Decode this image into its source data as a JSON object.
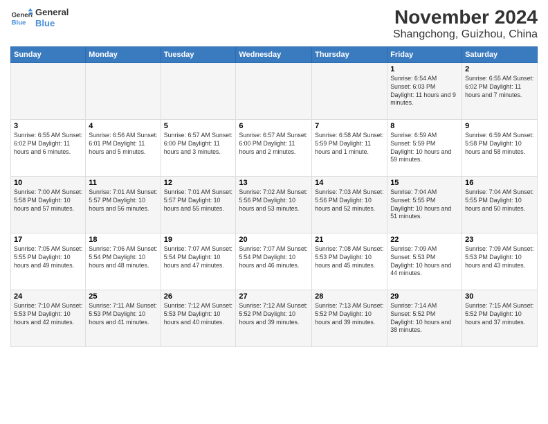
{
  "header": {
    "logo_line1": "General",
    "logo_line2": "Blue",
    "month": "November 2024",
    "location": "Shangchong, Guizhou, China"
  },
  "weekdays": [
    "Sunday",
    "Monday",
    "Tuesday",
    "Wednesday",
    "Thursday",
    "Friday",
    "Saturday"
  ],
  "weeks": [
    [
      {
        "day": "",
        "info": ""
      },
      {
        "day": "",
        "info": ""
      },
      {
        "day": "",
        "info": ""
      },
      {
        "day": "",
        "info": ""
      },
      {
        "day": "",
        "info": ""
      },
      {
        "day": "1",
        "info": "Sunrise: 6:54 AM\nSunset: 6:03 PM\nDaylight: 11 hours and 9 minutes."
      },
      {
        "day": "2",
        "info": "Sunrise: 6:55 AM\nSunset: 6:02 PM\nDaylight: 11 hours and 7 minutes."
      }
    ],
    [
      {
        "day": "3",
        "info": "Sunrise: 6:55 AM\nSunset: 6:02 PM\nDaylight: 11 hours and 6 minutes."
      },
      {
        "day": "4",
        "info": "Sunrise: 6:56 AM\nSunset: 6:01 PM\nDaylight: 11 hours and 5 minutes."
      },
      {
        "day": "5",
        "info": "Sunrise: 6:57 AM\nSunset: 6:00 PM\nDaylight: 11 hours and 3 minutes."
      },
      {
        "day": "6",
        "info": "Sunrise: 6:57 AM\nSunset: 6:00 PM\nDaylight: 11 hours and 2 minutes."
      },
      {
        "day": "7",
        "info": "Sunrise: 6:58 AM\nSunset: 5:59 PM\nDaylight: 11 hours and 1 minute."
      },
      {
        "day": "8",
        "info": "Sunrise: 6:59 AM\nSunset: 5:59 PM\nDaylight: 10 hours and 59 minutes."
      },
      {
        "day": "9",
        "info": "Sunrise: 6:59 AM\nSunset: 5:58 PM\nDaylight: 10 hours and 58 minutes."
      }
    ],
    [
      {
        "day": "10",
        "info": "Sunrise: 7:00 AM\nSunset: 5:58 PM\nDaylight: 10 hours and 57 minutes."
      },
      {
        "day": "11",
        "info": "Sunrise: 7:01 AM\nSunset: 5:57 PM\nDaylight: 10 hours and 56 minutes."
      },
      {
        "day": "12",
        "info": "Sunrise: 7:01 AM\nSunset: 5:57 PM\nDaylight: 10 hours and 55 minutes."
      },
      {
        "day": "13",
        "info": "Sunrise: 7:02 AM\nSunset: 5:56 PM\nDaylight: 10 hours and 53 minutes."
      },
      {
        "day": "14",
        "info": "Sunrise: 7:03 AM\nSunset: 5:56 PM\nDaylight: 10 hours and 52 minutes."
      },
      {
        "day": "15",
        "info": "Sunrise: 7:04 AM\nSunset: 5:55 PM\nDaylight: 10 hours and 51 minutes."
      },
      {
        "day": "16",
        "info": "Sunrise: 7:04 AM\nSunset: 5:55 PM\nDaylight: 10 hours and 50 minutes."
      }
    ],
    [
      {
        "day": "17",
        "info": "Sunrise: 7:05 AM\nSunset: 5:55 PM\nDaylight: 10 hours and 49 minutes."
      },
      {
        "day": "18",
        "info": "Sunrise: 7:06 AM\nSunset: 5:54 PM\nDaylight: 10 hours and 48 minutes."
      },
      {
        "day": "19",
        "info": "Sunrise: 7:07 AM\nSunset: 5:54 PM\nDaylight: 10 hours and 47 minutes."
      },
      {
        "day": "20",
        "info": "Sunrise: 7:07 AM\nSunset: 5:54 PM\nDaylight: 10 hours and 46 minutes."
      },
      {
        "day": "21",
        "info": "Sunrise: 7:08 AM\nSunset: 5:53 PM\nDaylight: 10 hours and 45 minutes."
      },
      {
        "day": "22",
        "info": "Sunrise: 7:09 AM\nSunset: 5:53 PM\nDaylight: 10 hours and 44 minutes."
      },
      {
        "day": "23",
        "info": "Sunrise: 7:09 AM\nSunset: 5:53 PM\nDaylight: 10 hours and 43 minutes."
      }
    ],
    [
      {
        "day": "24",
        "info": "Sunrise: 7:10 AM\nSunset: 5:53 PM\nDaylight: 10 hours and 42 minutes."
      },
      {
        "day": "25",
        "info": "Sunrise: 7:11 AM\nSunset: 5:53 PM\nDaylight: 10 hours and 41 minutes."
      },
      {
        "day": "26",
        "info": "Sunrise: 7:12 AM\nSunset: 5:53 PM\nDaylight: 10 hours and 40 minutes."
      },
      {
        "day": "27",
        "info": "Sunrise: 7:12 AM\nSunset: 5:52 PM\nDaylight: 10 hours and 39 minutes."
      },
      {
        "day": "28",
        "info": "Sunrise: 7:13 AM\nSunset: 5:52 PM\nDaylight: 10 hours and 39 minutes."
      },
      {
        "day": "29",
        "info": "Sunrise: 7:14 AM\nSunset: 5:52 PM\nDaylight: 10 hours and 38 minutes."
      },
      {
        "day": "30",
        "info": "Sunrise: 7:15 AM\nSunset: 5:52 PM\nDaylight: 10 hours and 37 minutes."
      }
    ]
  ]
}
